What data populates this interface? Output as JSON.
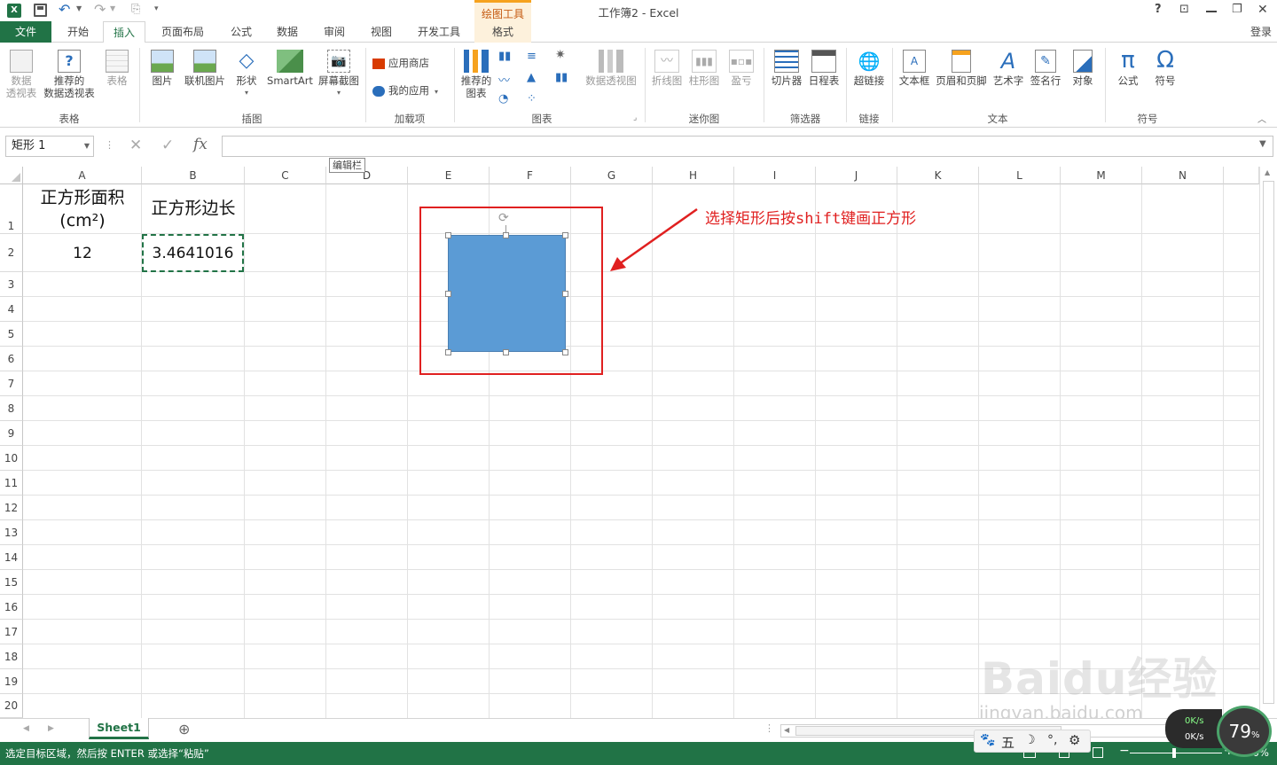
{
  "title_bar": {
    "window_title": "工作簿2 - Excel",
    "contextual_group": "绘图工具",
    "help": "?",
    "ribbon_display": "⊡",
    "restore": "❐",
    "close": "✕"
  },
  "tabs": {
    "file": "文件",
    "items": [
      "开始",
      "插入",
      "页面布局",
      "公式",
      "数据",
      "审阅",
      "视图",
      "开发工具"
    ],
    "active": "插入",
    "contextual_tab": "格式",
    "login": "登录"
  },
  "ribbon": {
    "groups": {
      "tables": "表格",
      "illustrations": "插图",
      "addins": "加载项",
      "charts": "图表",
      "sparklines": "迷你图",
      "filters": "筛选器",
      "links": "链接",
      "text": "文本",
      "symbols": "符号"
    },
    "buttons": {
      "pivot_line1": "数据",
      "pivot_line2": "透视表",
      "rec_pivot_line1": "推荐的",
      "rec_pivot_line2": "数据透视表",
      "table": "表格",
      "pictures": "图片",
      "online_pictures": "联机图片",
      "shapes": "形状",
      "smartart": "SmartArt",
      "screenshot": "屏幕截图",
      "store": "应用商店",
      "my_apps": "我的应用",
      "rec_charts_line1": "推荐的",
      "rec_charts_line2": "图表",
      "pivot_chart": "数据透视图",
      "line_sparkline": "折线图",
      "column_sparkline": "柱形图",
      "winloss": "盈亏",
      "slicer": "切片器",
      "timeline": "日程表",
      "hyperlink": "超链接",
      "textbox": "文本框",
      "header_footer": "页眉和页脚",
      "wordart": "艺术字",
      "signature": "签名行",
      "object": "对象",
      "equation": "公式",
      "symbol": "符号"
    }
  },
  "formula_bar": {
    "name_box": "矩形 1",
    "cancel": "✕",
    "enter": "✓",
    "fx": "fx",
    "tooltip": "编辑栏",
    "formula": ""
  },
  "grid": {
    "columns": [
      "A",
      "B",
      "C",
      "D",
      "E",
      "F",
      "G",
      "H",
      "I",
      "J",
      "K",
      "L",
      "M",
      "N"
    ],
    "rows": [
      "1",
      "2",
      "3",
      "4",
      "5",
      "6",
      "7",
      "8",
      "9",
      "10",
      "11",
      "12",
      "13",
      "14",
      "15",
      "16",
      "17",
      "18",
      "19",
      "20"
    ],
    "cells": {
      "A1_line1": "正方形面积",
      "A1_line2": "(cm²)",
      "B1": "正方形边长",
      "A2": "12",
      "B2": "3.4641016"
    }
  },
  "annotation": {
    "text": "选择矩形后按shift键画正方形",
    "color": "#e02020"
  },
  "shape": {
    "fill": "#5b9bd5",
    "name": "矩形 1"
  },
  "sheets": {
    "tabs": [
      "Sheet1"
    ],
    "active": "Sheet1",
    "add": "⊕"
  },
  "status_bar": {
    "message": "选定目标区域，然后按 ENTER 或选择“粘贴”",
    "zoom": "100%"
  },
  "overlay": {
    "watermark_brand": "Baidu经验",
    "watermark_url": "jingyan.baidu.com",
    "widget_percent": "79",
    "widget_up": "0K/s",
    "widget_down": "0K/s",
    "ime_label": "五"
  },
  "colors": {
    "excel_green": "#217346",
    "contextual_orange": "#f6a21e"
  }
}
